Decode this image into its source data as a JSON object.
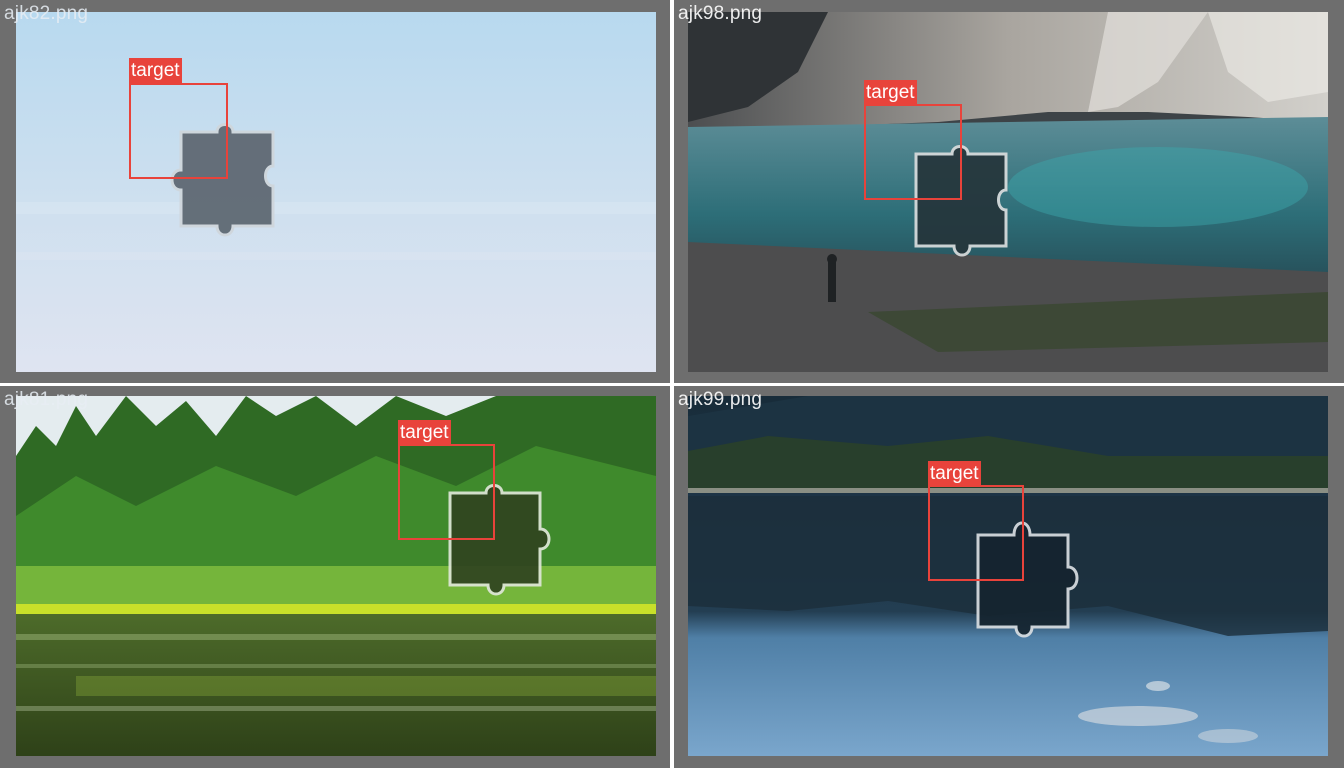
{
  "tiles": [
    {
      "filename": "ajk82.png",
      "label": "target",
      "scene": "pale blue sky"
    },
    {
      "filename": "ajk98.png",
      "label": "target",
      "scene": "mountain lake with hiker"
    },
    {
      "filename": "ajk81.png",
      "label": "target",
      "scene": "forest lake"
    },
    {
      "filename": "ajk99.png",
      "label": "target",
      "scene": "reflective lake at dusk"
    }
  ],
  "colors": {
    "frame": "#6e6e6e",
    "target_red": "#e8433b",
    "divider": "#ffffff"
  },
  "icons": {
    "piece": "puzzle-piece-icon"
  }
}
